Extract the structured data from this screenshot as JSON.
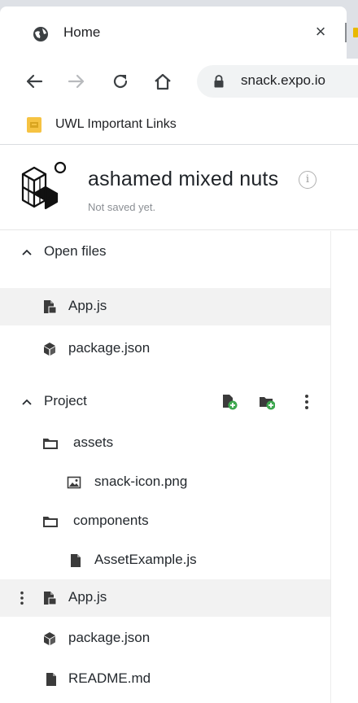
{
  "browser": {
    "tab": {
      "title": "Home",
      "close_glyph": "×",
      "favicon": "globe-icon"
    },
    "toolbar": {
      "back_glyph": "←",
      "forward_glyph": "→",
      "url": "snack.expo.io"
    },
    "bookmarks": [
      {
        "label": "UWL Important Links",
        "icon": "folder-yellow-icon"
      }
    ]
  },
  "snack": {
    "project_name": "ashamed mixed nuts",
    "info_glyph": "i",
    "save_status": "Not saved yet."
  },
  "sidebar": {
    "open_files": {
      "label": "Open files",
      "items": [
        {
          "label": "App.js",
          "icon": "js-file-icon",
          "active": true
        },
        {
          "label": "package.json",
          "icon": "package-icon",
          "active": false
        }
      ]
    },
    "project": {
      "label": "Project",
      "actions": [
        "new-file-icon",
        "new-folder-icon",
        "more-vertical-icon"
      ],
      "items": [
        {
          "label": "assets",
          "icon": "folder-icon",
          "depth": 1
        },
        {
          "label": "snack-icon.png",
          "icon": "image-file-icon",
          "depth": 2
        },
        {
          "label": "components",
          "icon": "folder-icon",
          "depth": 1
        },
        {
          "label": "AssetExample.js",
          "icon": "file-icon",
          "depth": 2
        },
        {
          "label": "App.js",
          "icon": "js-file-icon",
          "depth": 1,
          "active": true
        },
        {
          "label": "package.json",
          "icon": "package-icon",
          "depth": 1
        },
        {
          "label": "README.md",
          "icon": "file-icon",
          "depth": 1
        }
      ]
    }
  },
  "colors": {
    "tabstrip": "#dee1e6",
    "active_row": "#f2f2f2",
    "add_badge": "#3ea84f",
    "bookmark_folder": "#f6c342"
  }
}
